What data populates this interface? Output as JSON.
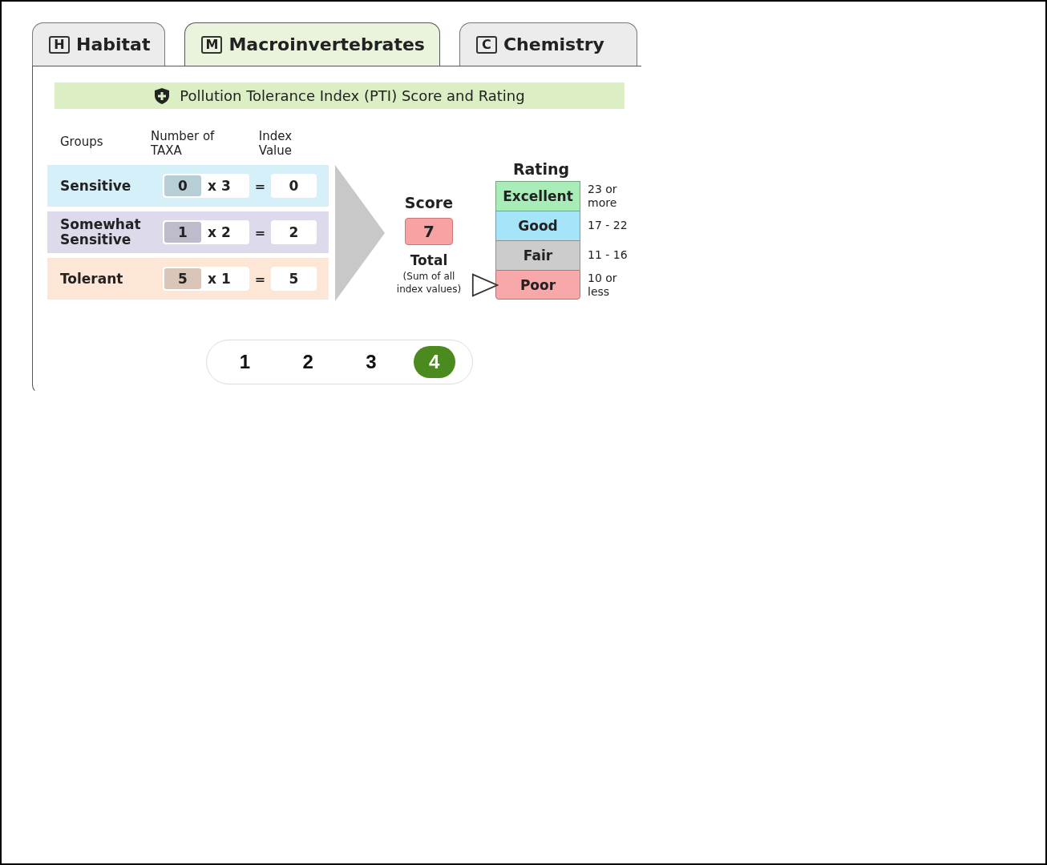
{
  "tabs": [
    {
      "icon_letter": "H",
      "label": "Habitat",
      "selected": false
    },
    {
      "icon_letter": "M",
      "label": "Macroinvertebrates",
      "selected": true
    },
    {
      "icon_letter": "C",
      "label": "Chemistry",
      "selected": false
    }
  ],
  "section_title": "Pollution Tolerance Index (PTI) Score and Rating",
  "table": {
    "columns": [
      "Groups",
      "Number of TAXA",
      "Index Value"
    ],
    "rows": [
      {
        "group": "Sensitive",
        "taxa": "0",
        "multiplier": "x 3",
        "equals": "=",
        "index_value": "0",
        "color": "#d6f0fa"
      },
      {
        "group": "Somewhat Sensitive",
        "taxa": "1",
        "multiplier": "x 2",
        "equals": "=",
        "index_value": "2",
        "color": "#dddbeb"
      },
      {
        "group": "Tolerant",
        "taxa": "5",
        "multiplier": "x 1",
        "equals": "=",
        "index_value": "5",
        "color": "#fde6d6"
      }
    ]
  },
  "score": {
    "heading": "Score",
    "value": "7",
    "label": "Total",
    "note": "(Sum of all index values)"
  },
  "rating": {
    "heading": "Rating",
    "bands": [
      {
        "label": "Excellent",
        "range": "23 or more",
        "color": "#a8ecb8",
        "selected": false
      },
      {
        "label": "Good",
        "range": "17 - 22",
        "color": "#a6e4f8",
        "selected": false
      },
      {
        "label": "Fair",
        "range": "11 - 16",
        "color": "#cccccc",
        "selected": false
      },
      {
        "label": "Poor",
        "range": "10 or less",
        "color": "#f8a8a8",
        "selected": true
      }
    ]
  },
  "pager": [
    {
      "label": "1",
      "selected": false
    },
    {
      "label": "2",
      "selected": false
    },
    {
      "label": "3",
      "selected": false
    },
    {
      "label": "4",
      "selected": true
    }
  ]
}
